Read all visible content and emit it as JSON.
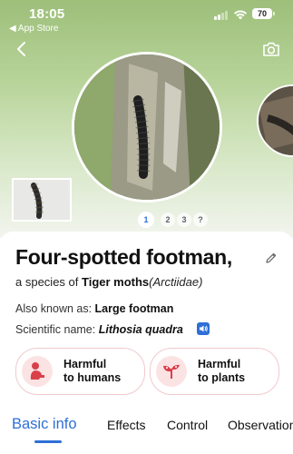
{
  "status_bar": {
    "time": "18:05",
    "back_app": "◀ App Store",
    "battery": "70"
  },
  "pager": {
    "pages": [
      "1",
      "2",
      "3",
      "?"
    ],
    "active": "1"
  },
  "species": {
    "name": "Four-spotted footman",
    "name_suffix": ",",
    "species_prefix": "a species of ",
    "family_common": "Tiger moths",
    "family_scientific": "(Arctiidae)",
    "aka_label": "Also known as: ",
    "aka_value": "Large footman",
    "sci_label": "Scientific name: ",
    "sci_value": "Lithosia quadra"
  },
  "cards": [
    {
      "line1": "Harmful",
      "line2": "to humans",
      "icon": "person-icon"
    },
    {
      "line1": "Harmful",
      "line2": "to plants",
      "icon": "plant-icon"
    }
  ],
  "tabs": [
    "Basic info",
    "Effects",
    "Control",
    "Observations"
  ],
  "colors": {
    "accent": "#2f6fd6",
    "harm_border": "#f0c9cd",
    "harm_icon": "#d9404a"
  }
}
